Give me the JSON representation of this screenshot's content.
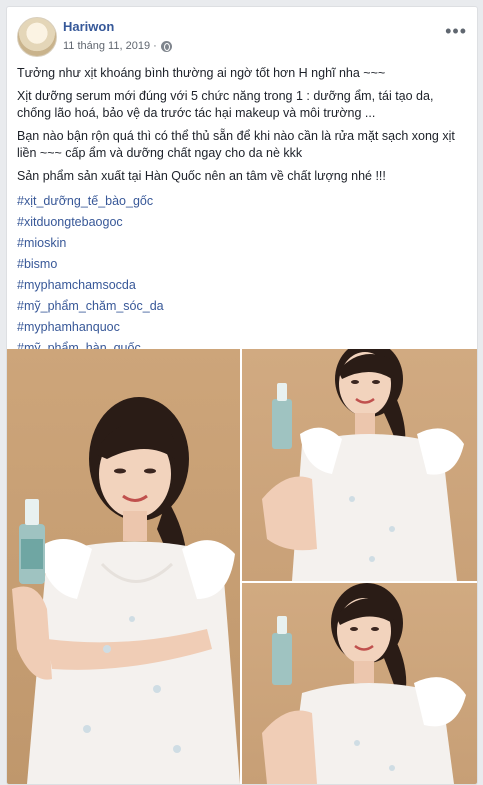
{
  "post": {
    "author": "Hariwon",
    "date": "11 tháng 11, 2019 ·",
    "privacy_icon": "globe-icon",
    "more_icon": "more-horizontal-icon",
    "more_label": "•••",
    "paragraphs": [
      "Tưởng như xịt khoáng bình thường ai ngờ tốt hơn H nghĩ nha ~~~",
      "Xịt dưỡng serum mới đúng với 5 chức năng trong 1 : dưỡng ẩm, tái tạo da, chống lão hoá, bảo vệ da trước tác hại makeup và môi trường ...",
      "Bạn nào bận rộn quá thì có thể thủ sẵn để khi nào cần là rửa mặt sạch xong xịt liền ~~~ cấp ẩm và dưỡng chất ngay cho da nè kkk",
      "Sản phẩm sản xuất tại Hàn Quốc nên an tâm về chất lượng nhé !!!"
    ],
    "hashtags": [
      "#xịt_dưỡng_tế_bào_gốc",
      "#xitduongtebaogoc",
      "#mioskin",
      "#bismo",
      "#myphamchamsocda",
      "#mỹ_phẩm_chăm_sóc_da",
      "#myphamhanquoc",
      "#mỹ_phẩm_hàn_quốc"
    ]
  },
  "colors": {
    "link": "#385898",
    "author": "#365899",
    "background": "#e9ebee",
    "photo_backdrop": "#c9a178"
  }
}
